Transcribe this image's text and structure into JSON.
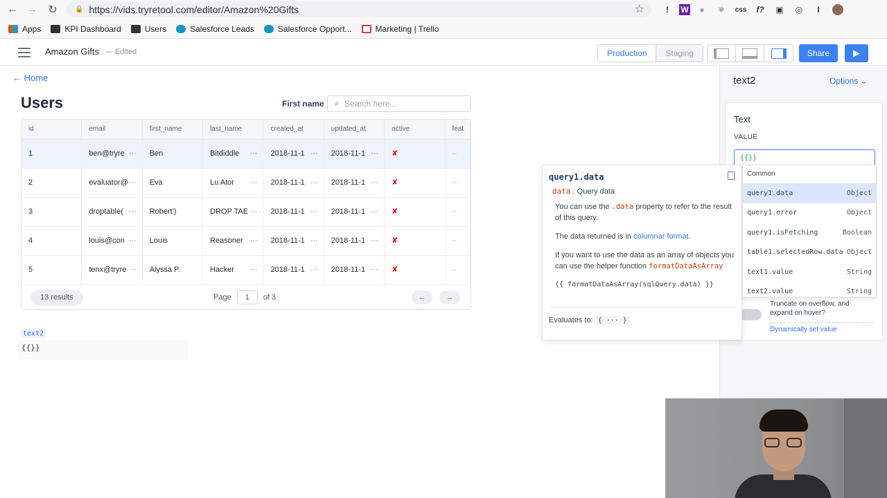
{
  "browser": {
    "url_host": "https://vids.tryretool.com",
    "url_path": "/editor/Amazon%20Gifts",
    "extensions": [
      "!",
      "W",
      "●",
      "⚛",
      "css",
      "f?",
      "▣",
      "◎",
      "I"
    ],
    "bookmarks": [
      {
        "label": "Apps",
        "color": "#e34c26"
      },
      {
        "label": "KPI Dashboard",
        "color": "#333333"
      },
      {
        "label": "Users",
        "color": "#333333"
      },
      {
        "label": "Salesforce Leads",
        "color": "#1798c1"
      },
      {
        "label": "Salesforce Opport...",
        "color": "#1798c1"
      },
      {
        "label": "Marketing | Trello",
        "color": "#d23b3b"
      }
    ]
  },
  "header": {
    "app_title": "Amazon Gifts",
    "edited": "— Edited",
    "env_production": "Production",
    "env_staging": "Staging",
    "share": "Share"
  },
  "canvas": {
    "home": "← Home",
    "title": "Users",
    "filter_label": "First name",
    "search_placeholder": "Search here...",
    "table": {
      "columns": [
        "id",
        "email",
        "first_name",
        "last_name",
        "created_at",
        "updated_at",
        "active",
        "feat"
      ],
      "rows": [
        [
          "1",
          "ben@tryre",
          "Ben",
          "Bitdiddle",
          "2018-11-1",
          "2018-11-1",
          "✘",
          "–"
        ],
        [
          "2",
          "evaluator@",
          "Eva",
          "Lu Ator",
          "2018-11-1",
          "2018-11-1",
          "✘",
          "–"
        ],
        [
          "3",
          "droptable(",
          "Robert')",
          "DROP TAE",
          "2018-11-1",
          "2018-11-1",
          "✘",
          "–"
        ],
        [
          "4",
          "louis@con",
          "Louis",
          "Reasoner",
          "2018-11-1",
          "2018-11-1",
          "✘",
          "–"
        ],
        [
          "5",
          "tenx@tryre",
          "Alyssa P.",
          "Hacker",
          "2018-11-1",
          "2018-11-1",
          "✘",
          "–"
        ]
      ],
      "results": "13 results",
      "page_label": "Page",
      "page_value": "1",
      "page_of": "of 3"
    },
    "text2_tag": "text2",
    "text2_value": "{{}}"
  },
  "right_panel": {
    "title": "text2",
    "options": "Options ⌄",
    "section_title": "Text",
    "value_label": "VALUE",
    "value_code": "{{}}",
    "truncate_label": "Truncate on overflow, and expand on hover?",
    "dynamic_link": "Dynamically set value"
  },
  "autocomplete": {
    "group": "Common",
    "items": [
      {
        "name": "query1.data",
        "type": "Object"
      },
      {
        "name": "query1.error",
        "type": "Object"
      },
      {
        "name": "query1.isFetching",
        "type": "Boolean"
      },
      {
        "name": "table1.selectedRow.data",
        "type": "Object"
      },
      {
        "name": "text1.value",
        "type": "String"
      },
      {
        "name": "text2.value",
        "type": "String"
      }
    ]
  },
  "doc_popup": {
    "title": "query1.data",
    "sub_key": "data",
    "sub_text": " : Query data",
    "p1_a": "You can use the ",
    "p1_code": ".data",
    "p1_b": " property to refer to the result of this query.",
    "p2_a": "The data returned is in ",
    "p2_link": "columnar format.",
    "p3_a": "If you want to use the data as an array of objects you can use the helper function ",
    "p3_code": "formatDataAsArray",
    "code": "{{ formatDataAsArray(sqlQuery.data) }}",
    "eval_label": "Evaluates to: ",
    "eval_value": "{ ··· }"
  }
}
